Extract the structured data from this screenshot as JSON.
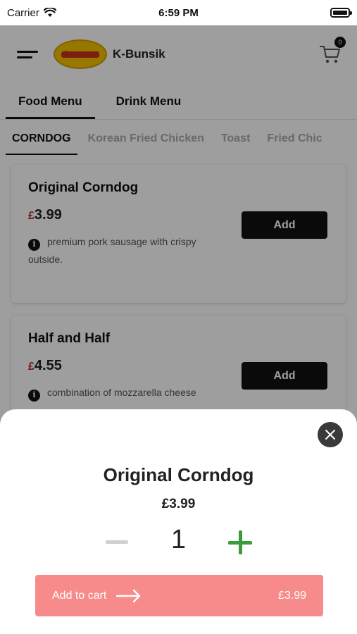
{
  "status_bar": {
    "carrier": "Carrier",
    "time": "6:59 PM"
  },
  "header": {
    "brand": "K-Bunsik",
    "cart_count": "0"
  },
  "menu_tabs": [
    "Food Menu",
    "Drink Menu"
  ],
  "category_tabs": [
    "CORNDOG",
    "Korean Fried Chicken",
    "Toast",
    "Fried Chic"
  ],
  "items": [
    {
      "name": "Original Corndog",
      "currency": "£",
      "price": "3.99",
      "description": "premium pork sausage with crispy outside.",
      "button": "Add"
    },
    {
      "name": "Half and Half",
      "currency": "£",
      "price": "4.55",
      "description": "combination of mozzarella cheese",
      "button": "Add"
    }
  ],
  "sheet": {
    "title": "Original Corndog",
    "price": "£3.99",
    "quantity": "1",
    "add_to_cart_label": "Add to cart",
    "total": "£3.99"
  },
  "colors": {
    "accent_add_cart": "#f78b8b",
    "plus": "#3a9b3a",
    "price_currency": "#c1272d"
  }
}
